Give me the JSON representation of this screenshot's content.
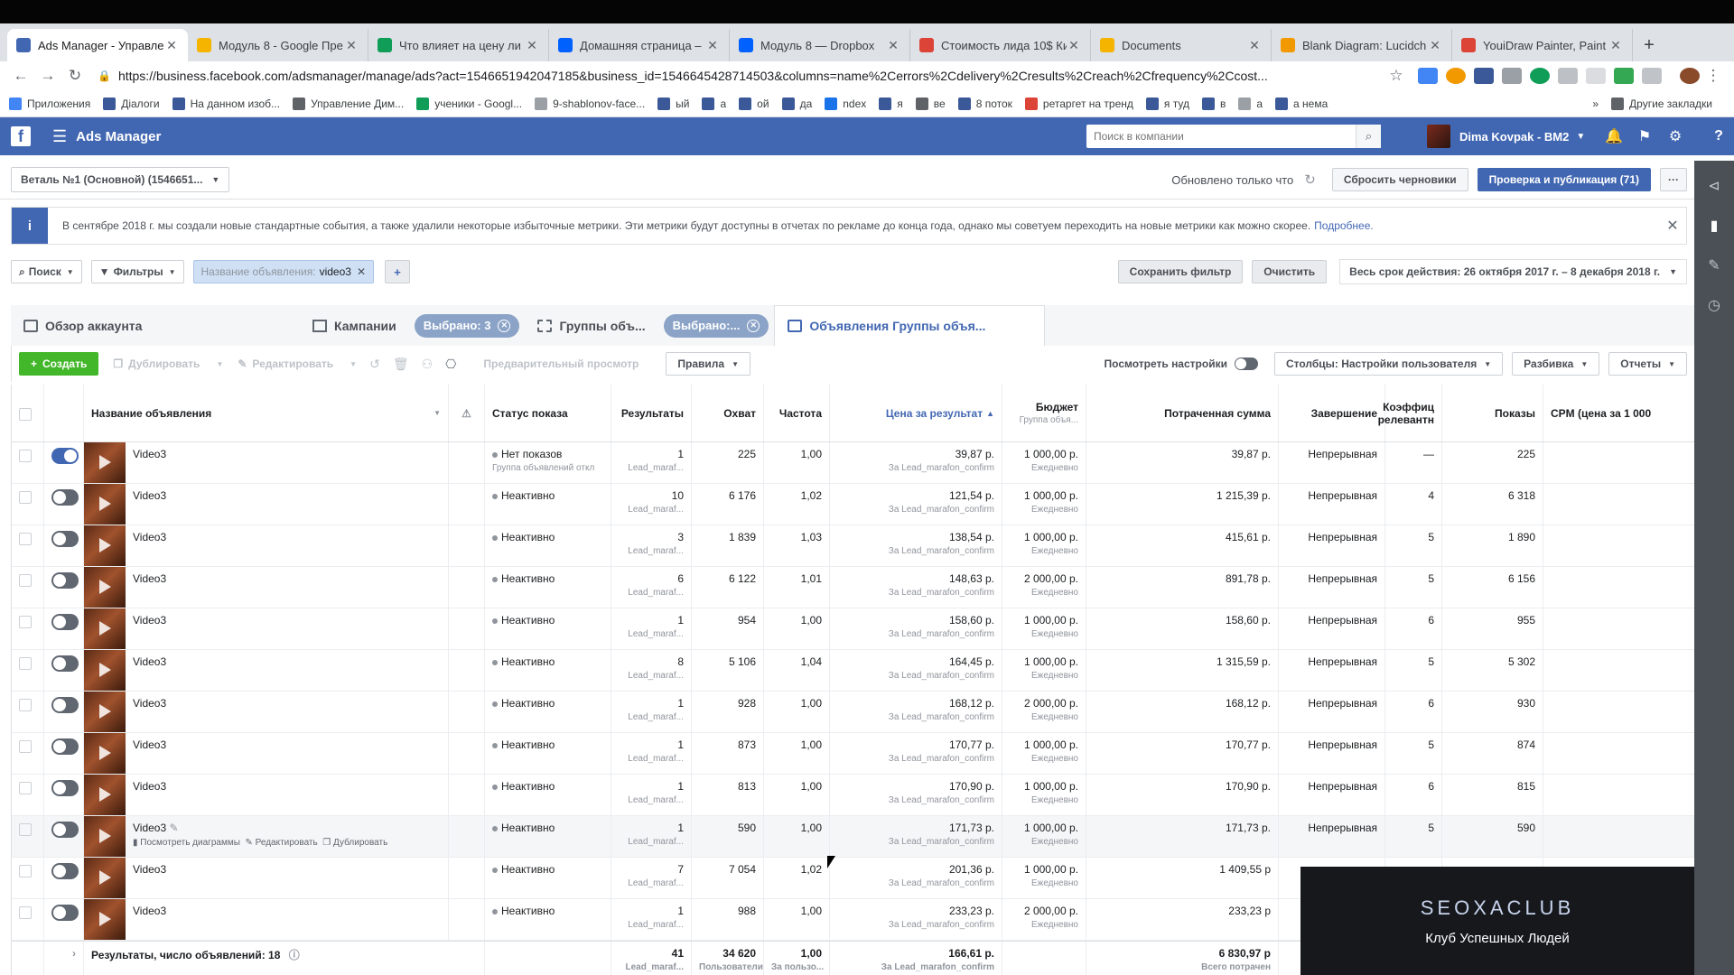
{
  "browser": {
    "tabs": [
      {
        "title": "Ads Manager - Управле",
        "color": "#4267b2",
        "active": true
      },
      {
        "title": "Модуль 8 - Google Пре",
        "color": "#f4b400"
      },
      {
        "title": "Что влияет на цену ли",
        "color": "#0f9d58"
      },
      {
        "title": "Домашняя страница –",
        "color": "#0061ff"
      },
      {
        "title": "Модуль 8 — Dropbox",
        "color": "#0061ff"
      },
      {
        "title": "Стоимость лида 10$ Ки",
        "color": "#db4437"
      },
      {
        "title": "Documents",
        "color": "#f4b400"
      },
      {
        "title": "Blank Diagram: Lucidch",
        "color": "#f29900"
      },
      {
        "title": "YouiDraw Painter, Paint",
        "color": "#db4437"
      }
    ],
    "url_host": "https://business.facebook.com",
    "url_path": "/adsmanager/manage/ads?act=1546651942047185&business_id=1546645428714503&columns=name%2Cerrors%2Cdelivery%2Cresults%2Creach%2Cfrequency%2Ccost...",
    "bookmarks": [
      "Приложения",
      "Діалоги",
      "На данном изоб...",
      "Управление Дим...",
      "ученики - Googl...",
      "9-shablonov-face...",
      "ый",
      "а",
      "ой",
      "да",
      "ndex",
      "я",
      "ве",
      "8 поток",
      "ретаргет на тренд",
      "я туд",
      "в",
      "а",
      "а нема"
    ],
    "bookmarks_more": "»",
    "other_bookmarks": "Другие закладки"
  },
  "header": {
    "app_title": "Ads Manager",
    "search_placeholder": "Поиск в компании",
    "user_name": "Dima Kovpak - BM2"
  },
  "account": {
    "selector": "Веталь №1 (Основной) (1546651...",
    "updated": "Обновлено только что",
    "discard": "Сбросить черновики",
    "publish": "Проверка и публикация (71)"
  },
  "notice": {
    "text": "В сентябре 2018 г. мы создали новые стандартные события, а также удалили некоторые избыточные метрики. Эти метрики будут доступны в отчетах по рекламе до конца года, однако мы советуем переходить на новые метрики как можно скорее.",
    "link": "Подробнее."
  },
  "filters": {
    "search": "Поиск",
    "filters": "Фильтры",
    "token_key": "Название объявления:",
    "token_value": "video3",
    "save_filter": "Сохранить фильтр",
    "clear": "Очистить",
    "date_range": "Весь срок действия: 26 октября 2017 г. – 8 декабря 2018 г."
  },
  "levels": {
    "overview": "Обзор аккаунта",
    "campaigns": "Кампании",
    "campaigns_selected": "Выбрано: 3",
    "adsets": "Группы объ...",
    "adsets_selected": "Выбрано:...",
    "ads": "Объявления Группы объя..."
  },
  "toolbar": {
    "create": "Создать",
    "duplicate": "Дублировать",
    "edit": "Редактировать",
    "preview": "Предварительный просмотр",
    "rules": "Правила",
    "view_settings": "Посмотреть настройки",
    "columns": "Столбцы: Настройки пользователя",
    "breakdown": "Разбивка",
    "reports": "Отчеты"
  },
  "columns": {
    "name": "Название объявления",
    "status": "Статус показа",
    "results": "Результаты",
    "reach": "Охват",
    "frequency": "Частота",
    "cpr": "Цена за результат",
    "budget": "Бюджет",
    "budget_sub": "Группа объя...",
    "spent": "Потраченная сумма",
    "end": "Завершение",
    "relevance": "Коэффиц релевантн",
    "impressions": "Показы",
    "cpm": "CPM (цена за 1 000"
  },
  "rows": [
    {
      "name": "Video3",
      "on": true,
      "status": "Нет показов",
      "status_sub": "Группа объявлений откл",
      "results": "1",
      "results_sub": "Lead_maraf...",
      "reach": "225",
      "freq": "1,00",
      "cpr": "39,87 р.",
      "cpr_sub": "За Lead_marafon_confirm",
      "budget": "1 000,00 р.",
      "budget_sub": "Ежедневно",
      "spent": "39,87 р.",
      "end": "Непрерывная",
      "rel": "—",
      "impr": "225"
    },
    {
      "name": "Video3",
      "on": false,
      "status": "Неактивно",
      "status_sub": "",
      "results": "10",
      "results_sub": "Lead_maraf...",
      "reach": "6 176",
      "freq": "1,02",
      "cpr": "121,54 р.",
      "cpr_sub": "За Lead_marafon_confirm",
      "budget": "1 000,00 р.",
      "budget_sub": "Ежедневно",
      "spent": "1 215,39 р.",
      "end": "Непрерывная",
      "rel": "4",
      "impr": "6 318"
    },
    {
      "name": "Video3",
      "on": false,
      "status": "Неактивно",
      "status_sub": "",
      "results": "3",
      "results_sub": "Lead_maraf...",
      "reach": "1 839",
      "freq": "1,03",
      "cpr": "138,54 р.",
      "cpr_sub": "За Lead_marafon_confirm",
      "budget": "1 000,00 р.",
      "budget_sub": "Ежедневно",
      "spent": "415,61 р.",
      "end": "Непрерывная",
      "rel": "5",
      "impr": "1 890"
    },
    {
      "name": "Video3",
      "on": false,
      "status": "Неактивно",
      "status_sub": "",
      "results": "6",
      "results_sub": "Lead_maraf...",
      "reach": "6 122",
      "freq": "1,01",
      "cpr": "148,63 р.",
      "cpr_sub": "За Lead_marafon_confirm",
      "budget": "2 000,00 р.",
      "budget_sub": "Ежедневно",
      "spent": "891,78 р.",
      "end": "Непрерывная",
      "rel": "5",
      "impr": "6 156"
    },
    {
      "name": "Video3",
      "on": false,
      "status": "Неактивно",
      "status_sub": "",
      "results": "1",
      "results_sub": "Lead_maraf...",
      "reach": "954",
      "freq": "1,00",
      "cpr": "158,60 р.",
      "cpr_sub": "За Lead_marafon_confirm",
      "budget": "1 000,00 р.",
      "budget_sub": "Ежедневно",
      "spent": "158,60 р.",
      "end": "Непрерывная",
      "rel": "6",
      "impr": "955"
    },
    {
      "name": "Video3",
      "on": false,
      "status": "Неактивно",
      "status_sub": "",
      "results": "8",
      "results_sub": "Lead_maraf...",
      "reach": "5 106",
      "freq": "1,04",
      "cpr": "164,45 р.",
      "cpr_sub": "За Lead_marafon_confirm",
      "budget": "1 000,00 р.",
      "budget_sub": "Ежедневно",
      "spent": "1 315,59 р.",
      "end": "Непрерывная",
      "rel": "5",
      "impr": "5 302"
    },
    {
      "name": "Video3",
      "on": false,
      "status": "Неактивно",
      "status_sub": "",
      "results": "1",
      "results_sub": "Lead_maraf...",
      "reach": "928",
      "freq": "1,00",
      "cpr": "168,12 р.",
      "cpr_sub": "За Lead_marafon_confirm",
      "budget": "2 000,00 р.",
      "budget_sub": "Ежедневно",
      "spent": "168,12 р.",
      "end": "Непрерывная",
      "rel": "6",
      "impr": "930"
    },
    {
      "name": "Video3",
      "on": false,
      "status": "Неактивно",
      "status_sub": "",
      "results": "1",
      "results_sub": "Lead_maraf...",
      "reach": "873",
      "freq": "1,00",
      "cpr": "170,77 р.",
      "cpr_sub": "За Lead_marafon_confirm",
      "budget": "1 000,00 р.",
      "budget_sub": "Ежедневно",
      "spent": "170,77 р.",
      "end": "Непрерывная",
      "rel": "5",
      "impr": "874"
    },
    {
      "name": "Video3",
      "on": false,
      "status": "Неактивно",
      "status_sub": "",
      "results": "1",
      "results_sub": "Lead_maraf...",
      "reach": "813",
      "freq": "1,00",
      "cpr": "170,90 р.",
      "cpr_sub": "За Lead_marafon_confirm",
      "budget": "1 000,00 р.",
      "budget_sub": "Ежедневно",
      "spent": "170,90 р.",
      "end": "Непрерывная",
      "rel": "6",
      "impr": "815"
    },
    {
      "name": "Video3",
      "on": false,
      "hover": true,
      "status": "Неактивно",
      "status_sub": "",
      "results": "1",
      "results_sub": "Lead_maraf...",
      "reach": "590",
      "freq": "1,00",
      "cpr": "171,73 р.",
      "cpr_sub": "За Lead_marafon_confirm",
      "budget": "1 000,00 р.",
      "budget_sub": "Ежедневно",
      "spent": "171,73 р.",
      "end": "Непрерывная",
      "rel": "5",
      "impr": "590"
    },
    {
      "name": "Video3",
      "on": false,
      "status": "Неактивно",
      "status_sub": "",
      "results": "7",
      "results_sub": "Lead_maraf...",
      "reach": "7 054",
      "freq": "1,02",
      "cpr": "201,36 р.",
      "cpr_sub": "За Lead_marafon_confirm",
      "budget": "1 000,00 р.",
      "budget_sub": "Ежедневно",
      "spent": "1 409,55 р",
      "end": "",
      "rel": "",
      "impr": ""
    },
    {
      "name": "Video3",
      "on": false,
      "status": "Неактивно",
      "status_sub": "",
      "results": "1",
      "results_sub": "Lead_maraf...",
      "reach": "988",
      "freq": "1,00",
      "cpr": "233,23 р.",
      "cpr_sub": "За Lead_marafon_confirm",
      "budget": "2 000,00 р.",
      "budget_sub": "Ежедневно",
      "spent": "233,23 р",
      "end": "",
      "rel": "",
      "impr": ""
    }
  ],
  "row_actions": {
    "charts": "Посмотреть диаграммы",
    "edit": "Редактировать",
    "duplicate": "Дублировать"
  },
  "summary": {
    "label": "Результаты, число объявлений: 18",
    "results": "41",
    "results_sub": "Lead_maraf...",
    "reach": "34 620",
    "reach_sub": "Пользователи",
    "freq": "1,00",
    "freq_sub": "За пользо...",
    "cpr": "166,61 р.",
    "cpr_sub": "За Lead_marafon_confirm",
    "spent": "6 830,97 р",
    "spent_sub": "Всего потрачен"
  },
  "overlay": {
    "brand": "SEOXACLUB",
    "slogan": "Клуб Успешных Людей"
  }
}
